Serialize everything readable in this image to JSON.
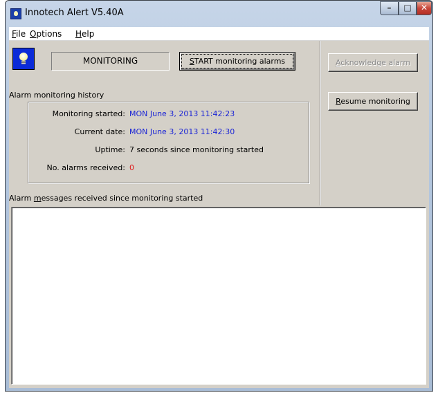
{
  "window": {
    "title": "Innotech Alert V5.40A",
    "caption_buttons": {
      "minimize": "–",
      "maximize": "□",
      "close": "✕"
    }
  },
  "menu": [
    {
      "label": "File",
      "mnemonic": "F",
      "rest": "ile"
    },
    {
      "label": "Options",
      "mnemonic": "O",
      "rest": "ptions"
    },
    {
      "label": "Help",
      "mnemonic": "H",
      "rest": "elp"
    }
  ],
  "status": {
    "text": "MONITORING"
  },
  "buttons": {
    "start": {
      "mnemonic": "S",
      "rest": "TART monitoring alarms"
    },
    "acknowledge": {
      "mnemonic": "A",
      "rest": "cknowledge alarm"
    },
    "resume": {
      "mnemonic": "R",
      "rest": "esume monitoring"
    }
  },
  "history": {
    "title": "Alarm monitoring history",
    "rows": [
      {
        "label": "Monitoring started:",
        "value": "MON June 3, 2013 11:42:23"
      },
      {
        "label": "Current date:",
        "value": "MON June 3, 2013 11:42:30"
      },
      {
        "label": "Uptime:",
        "value": "7 seconds since monitoring started"
      },
      {
        "label": "No. alarms received:",
        "value": "0"
      }
    ]
  },
  "messages": {
    "label_pre": "Alarm ",
    "label_mnemonic": "m",
    "label_post": "essages received since monitoring started"
  },
  "colors": {
    "value_blue": "#1a24d6",
    "alarm_count_red": "#e01a1a",
    "icon_blue": "#0b2bd8"
  }
}
